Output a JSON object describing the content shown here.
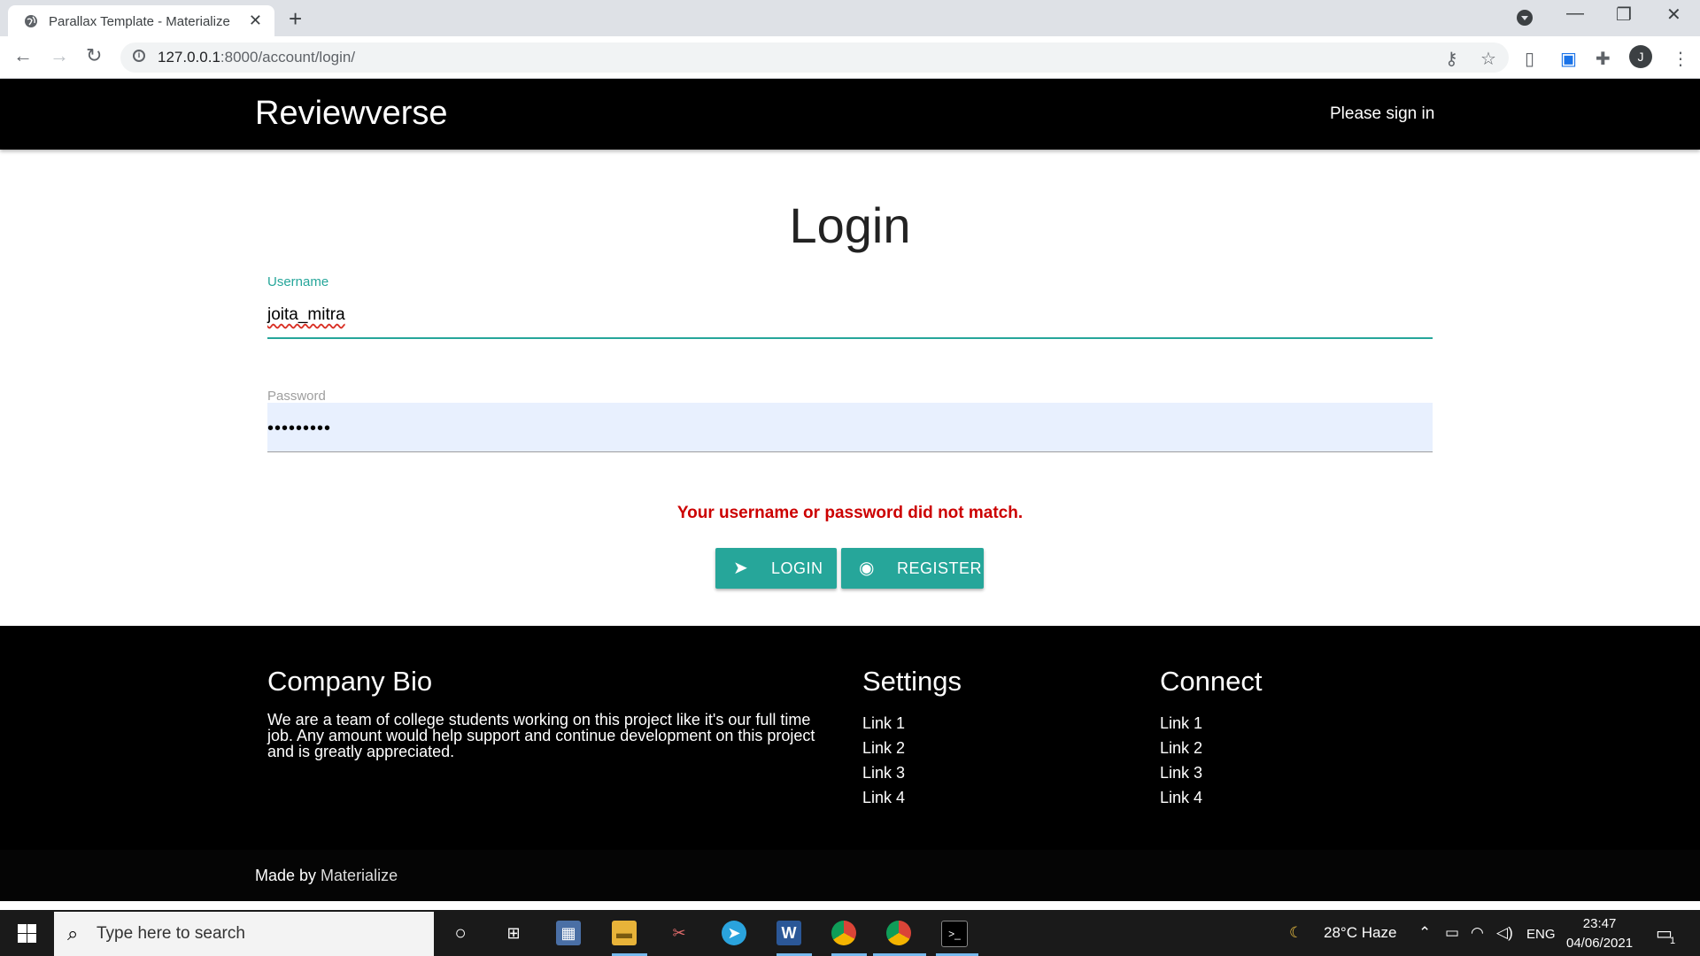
{
  "browser": {
    "tab_title": "Parallax Template - Materialize",
    "url_host": "127.0.0.1",
    "url_rest": ":8000/account/login/",
    "avatar_letter": "J"
  },
  "navbar": {
    "brand": "Reviewverse",
    "right_text": "Please sign in"
  },
  "login": {
    "title": "Login",
    "username_label": "Username",
    "username_value": "joita_mitra",
    "password_label": "Password",
    "password_value": "•••••••••",
    "error": "Your username or password did not match.",
    "login_button": "LOGIN",
    "register_button": "REGISTER"
  },
  "footer": {
    "bio_title": "Company Bio",
    "bio_text": "We are a team of college students working on this project like it's our full time job. Any amount would help support and continue development on this project and is greatly appreciated.",
    "settings_title": "Settings",
    "settings_links": [
      "Link 1",
      "Link 2",
      "Link 3",
      "Link 4"
    ],
    "connect_title": "Connect",
    "connect_links": [
      "Link 1",
      "Link 2",
      "Link 3",
      "Link 4"
    ],
    "made_by": "Made by ",
    "made_by_link": "Materialize"
  },
  "taskbar": {
    "search_placeholder": "Type here to search",
    "weather": "28°C  Haze",
    "language": "ENG",
    "time": "23:47",
    "date": "04/06/2021",
    "notification_count": "1"
  },
  "colors": {
    "accent": "#26a69a",
    "error": "#cc0000",
    "navbar_bg": "#000000",
    "autofill_bg": "#e8f0fe"
  }
}
